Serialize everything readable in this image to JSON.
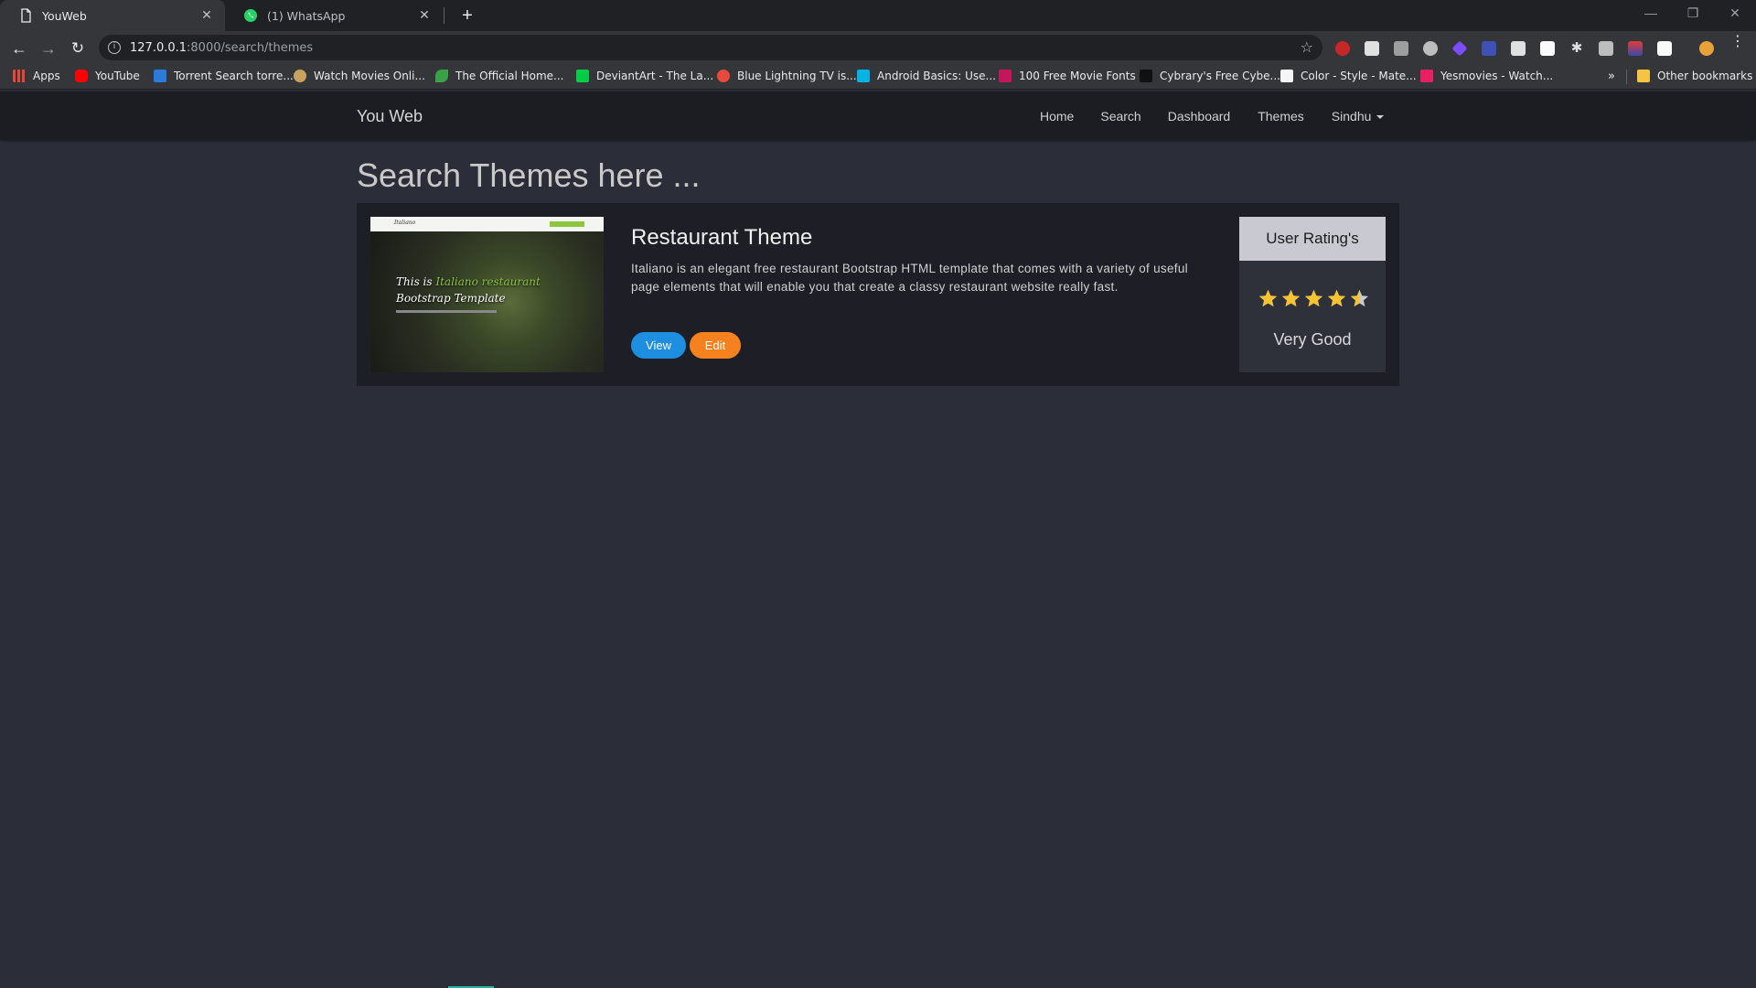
{
  "browser": {
    "tabs": [
      {
        "title": "YouWeb",
        "icon": "page-icon",
        "active": true
      },
      {
        "title": "(1) WhatsApp",
        "icon": "whatsapp-icon",
        "active": false
      }
    ],
    "address": {
      "host": "127.0.0.1",
      "path": ":8000/search/themes"
    },
    "bookmarks": [
      {
        "label": "Apps",
        "icon": "apps-grid-icon",
        "color": "#e8453c"
      },
      {
        "label": "YouTube",
        "icon": "youtube-icon",
        "color": "#ff0000"
      },
      {
        "label": "Torrent Search torre...",
        "icon": "torrent-icon",
        "color": "#2d7bd8"
      },
      {
        "label": "Watch Movies Onli...",
        "icon": "film-reel-icon",
        "color": "#c8a060"
      },
      {
        "label": "The Official Home...",
        "icon": "leaf-icon",
        "color": "#3aa04a"
      },
      {
        "label": "DeviantArt - The La...",
        "icon": "deviantart-icon",
        "color": "#05cc47"
      },
      {
        "label": "Blue Lightning TV is...",
        "icon": "bluelightning-icon",
        "color": "#e84a3c"
      },
      {
        "label": "Android Basics: Use...",
        "icon": "udacity-icon",
        "color": "#02b3e4"
      },
      {
        "label": "100 Free Movie Fonts",
        "icon": "fonts-icon",
        "color": "#c2185b"
      },
      {
        "label": "Cybrary's Free Cybe...",
        "icon": "cybrary-icon",
        "color": "#222222"
      },
      {
        "label": "Color - Style - Mate...",
        "icon": "material-icon",
        "color": "#f5f5f5"
      },
      {
        "label": "Yesmovies - Watch...",
        "icon": "yesmovies-icon",
        "color": "#e91e63"
      }
    ],
    "more_bookmarks": "»",
    "other_bookmarks": "Other bookmarks"
  },
  "site": {
    "brand": "You Web",
    "nav": [
      "Home",
      "Search",
      "Dashboard",
      "Themes",
      "Sindhu"
    ]
  },
  "page": {
    "heading": "Search Themes here ..."
  },
  "theme_card": {
    "title": "Restaurant Theme",
    "description": "Italiano is an elegant free restaurant Bootstrap HTML template that comes with a variety of useful page elements that will enable you that create a classy restaurant website really fast.",
    "view_label": "View",
    "edit_label": "Edit",
    "thumbnail": {
      "logo": "Italiano",
      "line1_a": "This is ",
      "line1_b": "Italiano restaurant",
      "line2": "Bootstrap Template"
    },
    "rating": {
      "header": "User Rating's",
      "value": 4.5,
      "max": 5,
      "label": "Very Good",
      "star_color": "#f7c331",
      "empty_color": "#c9c9d1"
    }
  }
}
